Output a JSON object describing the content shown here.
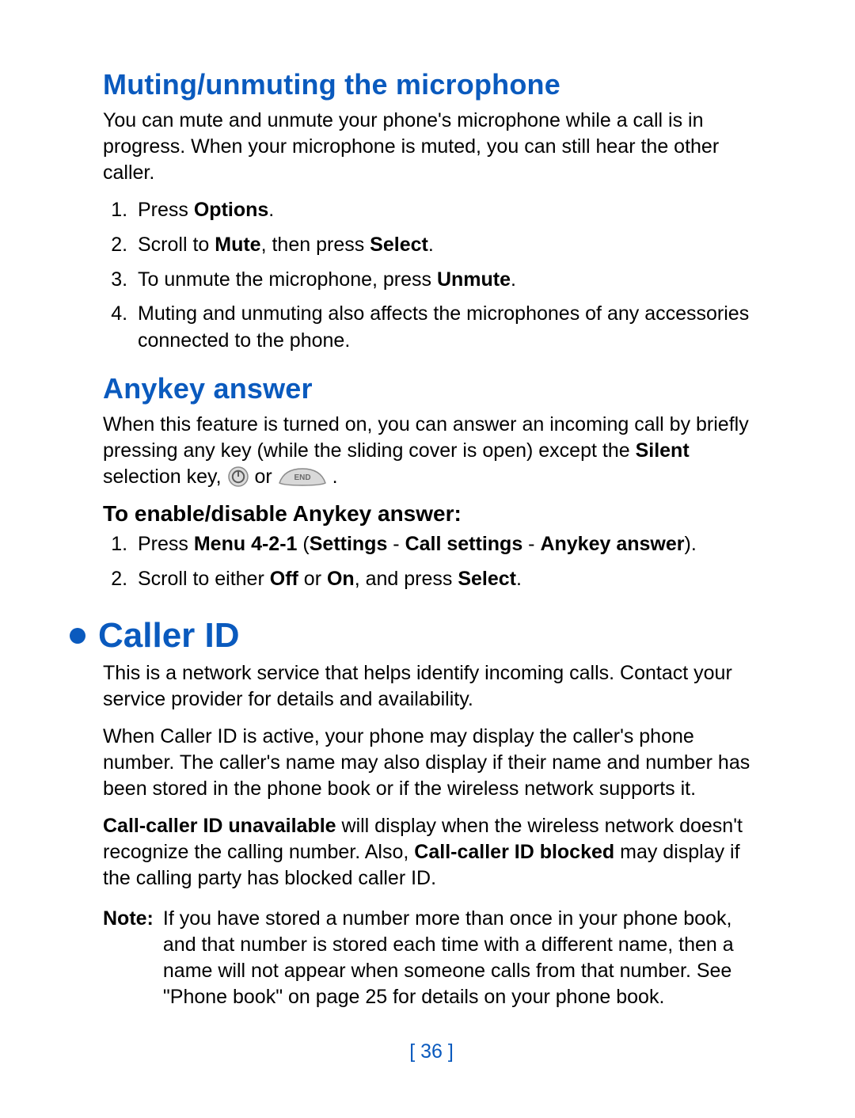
{
  "muting": {
    "heading": "Muting/unmuting the microphone",
    "intro": "You can mute and unmute your phone's microphone while a call is in progress. When your microphone is muted, you can still hear the other caller.",
    "steps": {
      "s1_pre": "Press ",
      "s1_b1": "Options",
      "s1_post": ".",
      "s2_pre": "Scroll to ",
      "s2_b1": "Mute",
      "s2_mid": ", then press ",
      "s2_b2": "Select",
      "s2_post": ".",
      "s3_pre": "To unmute the microphone, press ",
      "s3_b1": "Unmute",
      "s3_post": ".",
      "s4": "Muting and unmuting also affects the microphones of any accessories connected to the phone."
    }
  },
  "anykey": {
    "heading": "Anykey answer",
    "intro_pre": "When this feature is turned on, you can answer an incoming call by briefly pressing any key (while the sliding cover is open) except the ",
    "intro_b1": "Silent",
    "intro_mid": " selection key,  ",
    "intro_or": " or ",
    "intro_post": " .",
    "sub": "To enable/disable Anykey answer:",
    "steps": {
      "s1_pre": "Press ",
      "s1_b1": "Menu 4-2-1",
      "s1_mid1": " (",
      "s1_b2": "Settings",
      "s1_mid2": " - ",
      "s1_b3": "Call settings",
      "s1_mid3": " - ",
      "s1_b4": "Anykey answer",
      "s1_post": ").",
      "s2_pre": "Scroll to either ",
      "s2_b1": "Off",
      "s2_mid": " or ",
      "s2_b2": "On",
      "s2_mid2": ", and press ",
      "s2_b3": "Select",
      "s2_post": "."
    }
  },
  "callerid": {
    "section": "Caller ID",
    "p1": "This is a network service that helps identify incoming calls. Contact your service provider for details and availability.",
    "p2": "When Caller ID is active, your phone may display the caller's phone number. The caller's name may also display if their name and number has been stored in the phone book or if the wireless network supports it.",
    "p3_b1": "Call-caller ID unavailable",
    "p3_mid": " will display when the wireless network doesn't recognize the calling number. Also, ",
    "p3_b2": "Call-caller ID blocked",
    "p3_post": " may display if the calling party has blocked caller ID.",
    "note_label": "Note:",
    "note_text": "If you have stored a number more than once in your phone book, and that number is stored each time with a different name, then a name will not appear when someone calls from that number. See \"Phone book\" on page 25 for details on your phone book."
  },
  "page_number": "[ 36 ]",
  "icons": {
    "power": "power-icon",
    "end": "end-key-icon"
  }
}
